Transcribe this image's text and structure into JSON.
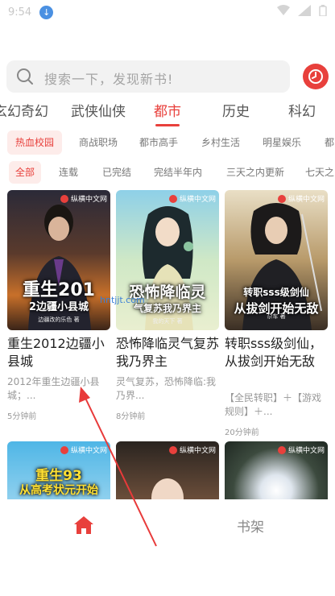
{
  "status_bar": {
    "time": "9:54"
  },
  "search": {
    "placeholder": "搜索一下，发现新书!"
  },
  "categories": [
    "玄幻奇幻",
    "武侠仙侠",
    "都市",
    "历史",
    "科幻"
  ],
  "active_category": "都市",
  "subcategories": [
    "热血校园",
    "商战职场",
    "都市高手",
    "乡村生活",
    "明星娱乐",
    "都"
  ],
  "filters": [
    "全部",
    "连载",
    "已完结",
    "完结半年内",
    "三天之内更新",
    "七天之"
  ],
  "books": [
    {
      "cover_text_line1": "重生201",
      "cover_text_line2": "2边疆小县城",
      "cover_author": "边疆改的乐色 著",
      "publisher": "纵横中文网",
      "title": "重生2012边疆小县城",
      "description": "2012年重生边疆小县城；...",
      "time": "5分钟前"
    },
    {
      "cover_text_line1": "恐怖降临灵",
      "cover_text_line2": "气复苏我乃界主",
      "cover_author": "我的天下 著",
      "publisher": "纵横中文网",
      "title": "恐怖降临灵气复苏我乃界主",
      "description": "灵气复苏，恐怖降临:我乃界...",
      "time": "8分钟前"
    },
    {
      "cover_text_line1": "转职sss级剑仙",
      "cover_text_line2": "从拔剑开始无敌",
      "cover_author": "尕车 著",
      "publisher": "纵横中文网",
      "title": "转职sss级剑仙，从拔剑开始无敌",
      "description": "【全民转职】＋【游戏规则】＋...",
      "time": "20分钟前"
    }
  ],
  "books_row2": [
    {
      "cover_text_line1": "重生93",
      "cover_text_line2": "从高考状元开始",
      "publisher": "纵横中文网"
    },
    {
      "publisher": "纵横中文网"
    },
    {
      "publisher": "纵横中文网"
    }
  ],
  "bottom_nav": {
    "shelf_label": "书架"
  },
  "watermark": "hntjjt.com",
  "colors": {
    "accent": "#e8403c",
    "pill_bg": "#fdecea",
    "search_bg": "#f2f2f2"
  }
}
